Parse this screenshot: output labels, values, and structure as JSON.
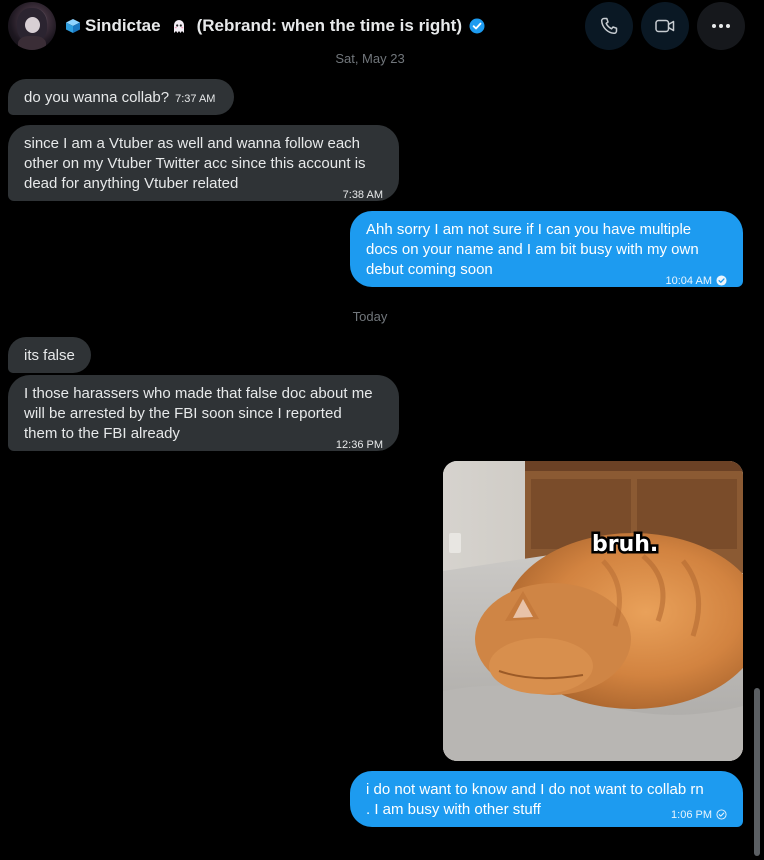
{
  "header": {
    "name": "Sindictae",
    "suffix": "(Rebrand: when the time is right)",
    "icons": {
      "cube": "cube-icon",
      "ghost": "ghost-icon",
      "verified": "verified-icon",
      "call": "phone-icon",
      "video": "video-icon",
      "more": "more-icon"
    }
  },
  "date_separators": [
    "Sat, May 23",
    "Today"
  ],
  "messages": [
    {
      "direction": "in",
      "text": "do you wanna collab?",
      "time": "7:37 AM"
    },
    {
      "direction": "in",
      "text": "since I am a Vtuber as well and wanna follow each\nother on my Vtuber Twitter acc since this account is\ndead for anything Vtuber related",
      "time": "7:38 AM"
    },
    {
      "direction": "out",
      "text": "Ahh sorry I am not sure if I can you have multiple\ndocs on your name and I am bit busy with my own\ndebut coming soon",
      "time": "10:04 AM"
    },
    {
      "direction": "in",
      "text": "its false",
      "time": ""
    },
    {
      "direction": "in",
      "text": "I those harassers who made that false doc about me\nwill be arrested by the FBI soon since I reported\nthem to the FBI already",
      "time": "12:36 PM"
    },
    {
      "direction": "out",
      "image_caption": "bruh.",
      "time": ""
    },
    {
      "direction": "out",
      "text": "i do not want to know and I do not want to collab rn\n. I am busy with other stuff",
      "time": "1:06 PM"
    }
  ],
  "colors": {
    "incoming_bubble": "#2f3336",
    "outgoing_bubble": "#1d9bf0",
    "background": "#000000",
    "muted_text": "#71767b",
    "verified": "#1d9bf0"
  }
}
